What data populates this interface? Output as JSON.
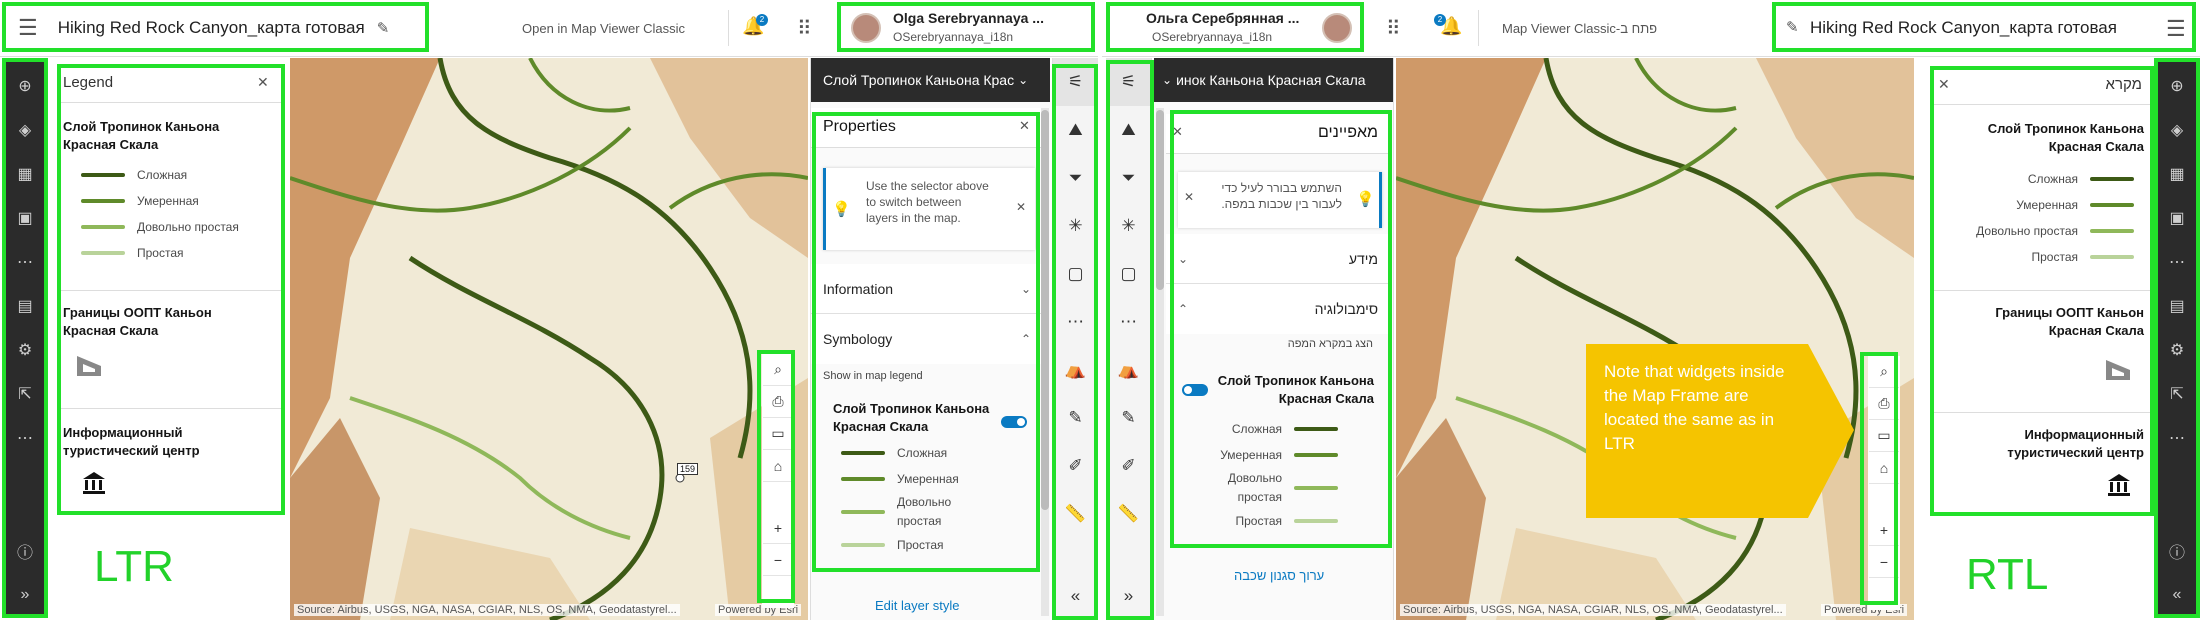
{
  "ltr": {
    "header": {
      "title": "Hiking Red Rock Canyon_карта готовая",
      "open_classic": "Open in Map Viewer Classic",
      "notif_count": "2",
      "user_name": "Olga Serebryannaya ...",
      "user_id": "OSerebryannaya_i18n"
    },
    "legend": {
      "heading": "Legend",
      "layer1_title": "Слой Тропинок Каньона Красная Скала",
      "layer1_items": [
        "Сложная",
        "Умеренная",
        "Довольно простая",
        "Простая"
      ],
      "layer2_title": "Границы ООПТ Каньон Красная Скала",
      "layer3_title": "Информационный туристический центр"
    },
    "dir_label": "LTR",
    "map": {
      "attribution": "Source: Airbus, USGS, NGA, NASA, CGIAR, NLS, OS, NMA, Geodatastyrel...",
      "powered": "Powered by Esri",
      "road": "159"
    },
    "properties": {
      "layer_selector": "Слой Тропинок Каньона Крас",
      "heading": "Properties",
      "tip": "Use the selector above to switch between layers in the map.",
      "information": "Information",
      "symbology": "Symbology",
      "show_in_legend": "Show in map legend",
      "layer_title": "Слой Тропинок Каньона Красная Скала",
      "items": [
        "Сложная",
        "Умеренная",
        "Довольно простая",
        "Простая"
      ],
      "edit_style": "Edit layer style"
    }
  },
  "rtl": {
    "header": {
      "title": "Hiking Red Rock Canyon_карта готовая",
      "open_classic": "Map Viewer Classic-פתח ב",
      "notif_count": "2",
      "user_name": "Ольга Серебрянная ...",
      "user_id": "OSerebryannaya_i18n"
    },
    "legend": {
      "heading": "מקרא",
      "layer1_title": "Слой Тропинок Каньона Красная Скала",
      "layer1_items": [
        "Сложная",
        "Умеренная",
        "Довольно простая",
        "Простая"
      ],
      "layer2_title": "Границы ООПТ Каньон Красная Скала",
      "layer3_title": "Информационный туристический центр"
    },
    "dir_label": "RTL",
    "map": {
      "attribution": "Source: Airbus, USGS, NGA, NASA, CGIAR, NLS, OS, NMA, Geodatastyrel...",
      "powered": "Powered by Esri"
    },
    "properties": {
      "layer_selector": "инок Каньона Красная Скала",
      "heading": "מאפיינים",
      "tip": "השתמש בבורר לעיל כדי לעבור בין שכבות במפה.",
      "information": "מידע",
      "symbology": "סימבולוגיה",
      "show_in_legend": "הצג במקרא המפה",
      "layer_title": "Слой Тропинок Каньона Красная Скала",
      "items": [
        "Сложная",
        "Умеренная",
        "Довольно простая",
        "Простая"
      ],
      "edit_style": "ערוך סגנון שכבה"
    }
  },
  "callout": "Note that widgets inside the Map Frame are located the same as in LTR",
  "colors": {
    "highlight": "#22e02a",
    "trail_hard": "#3d5a16",
    "trail_moderate": "#5f8a2a",
    "trail_easy_ish": "#8fb85a",
    "trail_easy": "#b9d39a",
    "callout_bg": "#f5c400",
    "accent": "#0a7ac2"
  }
}
